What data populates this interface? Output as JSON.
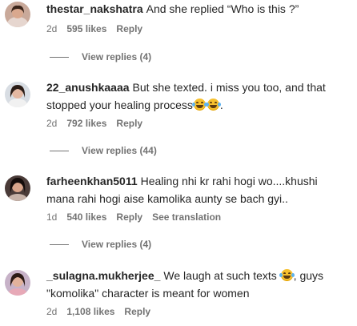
{
  "comments": [
    {
      "username": "thestar_nakshatra",
      "text": "And she replied “Who is this ?”",
      "time": "2d",
      "likes": "595 likes",
      "reply_label": "Reply",
      "view_replies": "View replies (4)"
    },
    {
      "username": "22_anushkaaaa",
      "text": "But she texted. i miss you too, and that stopped your healing process",
      "text_end": ".",
      "time": "2d",
      "likes": "792 likes",
      "reply_label": "Reply",
      "view_replies": "View replies (44)"
    },
    {
      "username": "farheenkhan5011",
      "text": "Healing nhi kr rahi hogi wo....khushi mana rahi hogi aise kamolika aunty se bach gyi..",
      "time": "1d",
      "likes": "540 likes",
      "reply_label": "Reply",
      "translation_label": "See translation",
      "view_replies": "View replies (4)"
    },
    {
      "username": "_sulagna.mukherjee_",
      "text": "We laugh at such texts",
      "text_end": ", guys \"komolika\" character is meant for women",
      "time": "2d",
      "likes": "1,108 likes",
      "reply_label": "Reply"
    }
  ],
  "colors": {
    "text": "#262626",
    "secondary": "#737373",
    "emoji": "#f6c02d"
  },
  "icons": {
    "emoji": "face-with-tears-of-joy-emoji"
  }
}
